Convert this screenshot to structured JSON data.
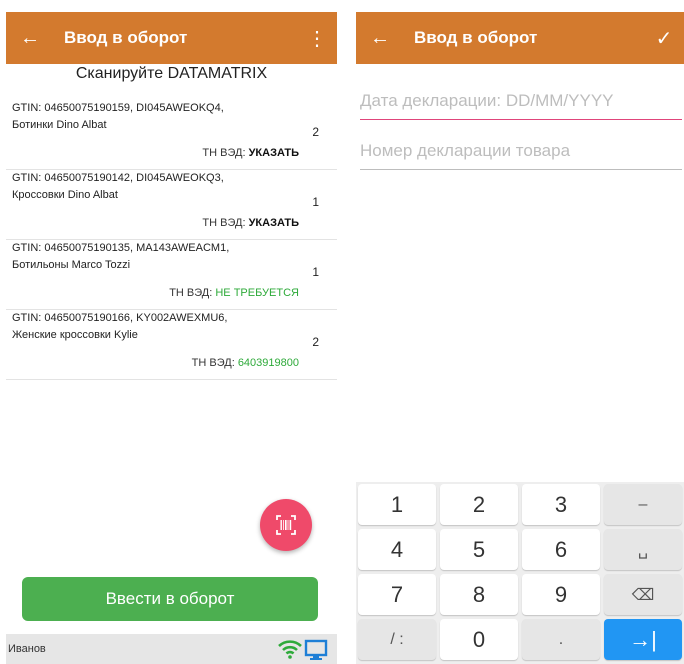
{
  "left": {
    "appbar": {
      "back_icon": "arrow-left-icon",
      "title": "Ввод в оборот",
      "menu_icon": "more-vert-icon"
    },
    "scan_title": "Сканируйте DATAMATRIX",
    "items": [
      {
        "line1": "GTIN: 04650075190159, DI045AWEOKQ4,",
        "line2": "Ботинки Dino Albat",
        "qty": "2",
        "tnved_label": "ТН ВЭД:",
        "tnved_value": "УКАЗАТЬ"
      },
      {
        "line1": "GTIN: 04650075190142, DI045AWEOKQ3,",
        "line2": "Кроссовки Dino Albat",
        "qty": "1",
        "tnved_label": "ТН ВЭД:",
        "tnved_value": "УКАЗАТЬ"
      },
      {
        "line1": "GTIN: 04650075190135, MA143AWEACM1,",
        "line2": "Ботильоны Marco Tozzi",
        "qty": "1",
        "tnved_label": "ТН ВЭД:",
        "tnved_value": "НЕ ТРЕБУЕТСЯ"
      },
      {
        "line1": "GTIN: 04650075190166, KY002AWEXMU6,",
        "line2": "Женские кроссовки Kylie",
        "qty": "2",
        "tnved_label": "ТН ВЭД:",
        "tnved_value": "6403919800"
      }
    ],
    "fab_icon": "barcode-scan-icon",
    "enter_button": "Ввести в оборот",
    "status": {
      "user": "Иванов",
      "wifi_icon": "wifi-icon",
      "monitor_icon": "monitor-icon"
    }
  },
  "right": {
    "appbar": {
      "back_icon": "arrow-left-icon",
      "title": "Ввод в оборот",
      "confirm_icon": "check-icon"
    },
    "date_field": {
      "placeholder": "Дата декларации: DD/MM/YYYY"
    },
    "number_field": {
      "placeholder": "Номер декларации товара"
    },
    "keypad": {
      "keys": [
        "1",
        "2",
        "3",
        "–",
        "4",
        "5",
        "6",
        "␣",
        "7",
        "8",
        "9",
        "⌫",
        "/ :",
        "0",
        ".",
        "→|"
      ]
    }
  },
  "colors": {
    "appbar": "#d37a2e",
    "accent_pink": "#ef4a6a",
    "button_green": "#4caf50",
    "ok_green": "#2eaa3a",
    "keypad_blue": "#2196f3"
  }
}
